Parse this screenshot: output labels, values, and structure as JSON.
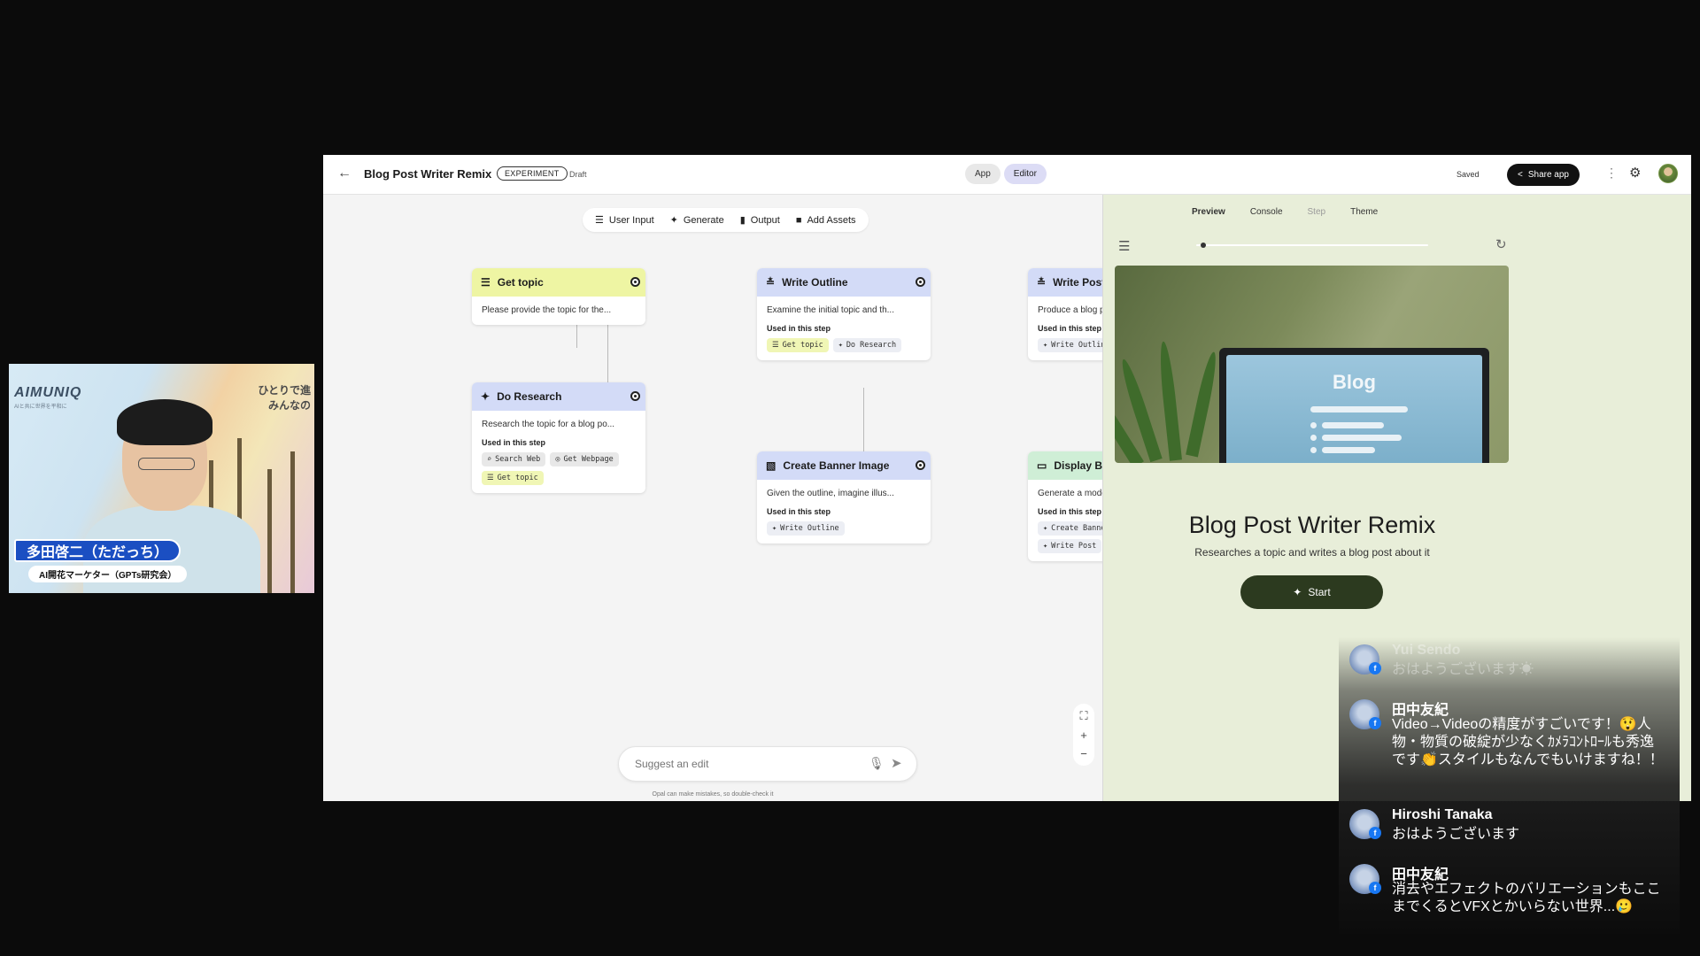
{
  "header": {
    "title": "Blog Post Writer Remix",
    "badge": "EXPERIMENT",
    "status": "Draft",
    "modes": [
      "App",
      "Editor"
    ],
    "saved": "Saved",
    "share_label": "Share app"
  },
  "toolbar": {
    "items": [
      "User Input",
      "Generate",
      "Output",
      "Add Assets"
    ]
  },
  "nodes": [
    {
      "title": "Get topic",
      "desc": "Please provide the topic for the...",
      "used_label": "",
      "chips": []
    },
    {
      "title": "Do Research",
      "desc": "Research the topic for a blog po...",
      "used_label": "Used in this step",
      "chips": [
        "Search Web",
        "Get Webpage",
        "Get topic"
      ]
    },
    {
      "title": "Write Outline",
      "desc": "Examine the initial topic and th...",
      "used_label": "Used in this step",
      "chips": [
        "Get topic",
        "Do Research"
      ]
    },
    {
      "title": "Write Post",
      "desc": "Produce a blog post using the th...",
      "used_label": "Used in this step",
      "chips": [
        "Write Outline"
      ]
    },
    {
      "title": "Create Banner Image",
      "desc": "Given the outline, imagine illus...",
      "used_label": "Used in this step",
      "chips": [
        "Write Outline"
      ]
    },
    {
      "title": "Display Blog Post",
      "desc": "Generate a modern looking blog p...",
      "used_label": "Used in this step",
      "chips": [
        "Create Banner Image",
        "Write Post"
      ]
    }
  ],
  "suggest": {
    "placeholder": "Suggest an edit",
    "disclaimer": "Opal can make mistakes, so double-check it"
  },
  "preview": {
    "tabs": [
      "Preview",
      "Console",
      "Step",
      "Theme"
    ],
    "hero_text": "Blog",
    "title": "Blog Post Writer Remix",
    "subtitle": "Researches a topic and writes a blog post about it",
    "start_label": "Start",
    "progress": 0.02
  },
  "webcam": {
    "brand": "AIMUNIQ",
    "tagline": "AIと共に世界を平和に",
    "right_text_1": "ひとりで進",
    "right_text_2": "みんなの",
    "name": "多田啓二（ただっち）",
    "role": "AI開花マーケター（GPTs研究会）"
  },
  "chat": [
    {
      "name": "Yui Sendo",
      "text": "おはようございます☀"
    },
    {
      "name": "田中友紀",
      "text": "Video→Videoの精度がすごいです！😲人物・物質の破綻が少なくｶﾒﾗｺﾝﾄﾛｰﾙも秀逸です👏スタイルもなんでもいけますね！！"
    },
    {
      "name": "Hiroshi Tanaka",
      "text": "おはようございます"
    },
    {
      "name": "田中友紀",
      "text": "消去やエフェクトのバリエーションもここまでくるとVFXとかいらない世界...🥲"
    }
  ],
  "colors": {
    "node_yellow": "#eef5a3",
    "node_blue": "#d3dbf7",
    "node_green": "#cfeed6",
    "preview_bg": "#e8eed9",
    "start_btn": "#2c3a1f",
    "share_btn": "#111111",
    "name_banner": "#1b4fc2"
  },
  "icons": {
    "back": "arrow-left-icon",
    "share": "share-icon",
    "settings": "gear-icon",
    "node_input": "list-icon",
    "node_generate": "sparkle-icon",
    "node_output": "display-icon",
    "mic": "mic-icon",
    "send": "send-icon"
  }
}
